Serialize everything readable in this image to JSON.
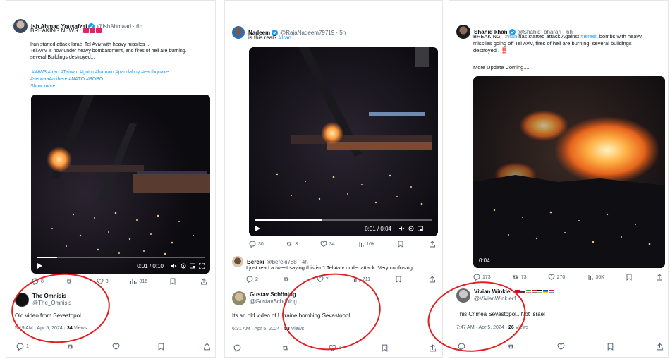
{
  "tweets": [
    {
      "name": "Ish Ahmad Yousafzai",
      "handle": "@IshAhmaad · 6h",
      "header_line": "BREAKING NEWS :",
      "body": [
        "Iran started attack Israel Tel Aviv with heavy missiles ...",
        "Tel Aviv is now under heavy bombardment, and fires of hell are burning.",
        "several Buildings destroyed..."
      ],
      "hashtags_1": ".#WW3 #Iran #Taiwan #gntm #hamain #pandabuy #earthquake",
      "hashtags_2": "#serwaaAmihere #NATO #BOBO...",
      "show_more": "Show more",
      "video_time": "0:01 / 0:10",
      "progress": 0.12,
      "stats": {
        "replies": "8",
        "reposts": "",
        "likes": "3",
        "views": "816"
      },
      "reply": {
        "name": "The Omnisis",
        "handle": "@The_Omnisis",
        "text": "Old video from Sevastopol",
        "time": "5:19 AM · Apr 5, 2024 · ",
        "views_count": "34",
        "views_label": "Views",
        "bar": {
          "replies": "1",
          "reposts": "",
          "likes": ""
        }
      }
    },
    {
      "name": "Nadeem",
      "handle": "@RajaNadeem79719 · 5h",
      "body_prefix": "is this real?",
      "body_tag": "#Iran",
      "video_time": "0:01 / 0:04",
      "progress": 0.38,
      "stats": {
        "replies": "30",
        "reposts": "3",
        "likes": "34",
        "views": "16K"
      },
      "comment": {
        "name": "Bereki",
        "handle": "@bereki788 · 4h",
        "text": "I just read a tweet saying this isn't Tel Aviv under attack. Very confusing",
        "stats": {
          "replies": "2",
          "reposts": "",
          "likes": "7",
          "views": "711"
        }
      },
      "reply": {
        "name": "Gustav Schöning",
        "handle": "@GustavSchöning",
        "text": "Its an old video of Ukraine bombing Sevastopol.",
        "time": "6:31 AM · Apr 5, 2024 · ",
        "views_count": "53",
        "views_label": "Views",
        "bar": {
          "replies": "",
          "reposts": "",
          "likes": "1"
        }
      }
    },
    {
      "name": "Shahid khan",
      "handle": "@Shahid_bharari · 6h",
      "body_1_prefix": "BREAKING– ",
      "body_1_tag1": "#Iran",
      "body_1_mid": " has started attack Against ",
      "body_1_tag2": "#Israel",
      "body_1_suffix": ", bombs with heavy",
      "body_2": "missiles going off Tel Aviv, fires of hell are burning, several buildings",
      "body_3": "destroyed .",
      "exclaim": "‼️",
      "more_update": "More Update Coming....",
      "video_time": "0:04",
      "stats": {
        "replies": "173",
        "reposts": "73",
        "likes": "270",
        "views": "36K"
      },
      "reply": {
        "name": "Vivian Winkler",
        "handle": "@VivianWinkler1",
        "text": "This Crimea Sevastopol.. Not Israel",
        "time": "7:47 AM · Apr 5, 2024 · ",
        "views_count": "26",
        "views_label": "Views",
        "bar": {
          "replies": "",
          "reposts": "",
          "likes": ""
        }
      }
    }
  ],
  "colors": {
    "accent": "#1d9bf0",
    "muted": "#536471",
    "annotation": "#e02020"
  }
}
